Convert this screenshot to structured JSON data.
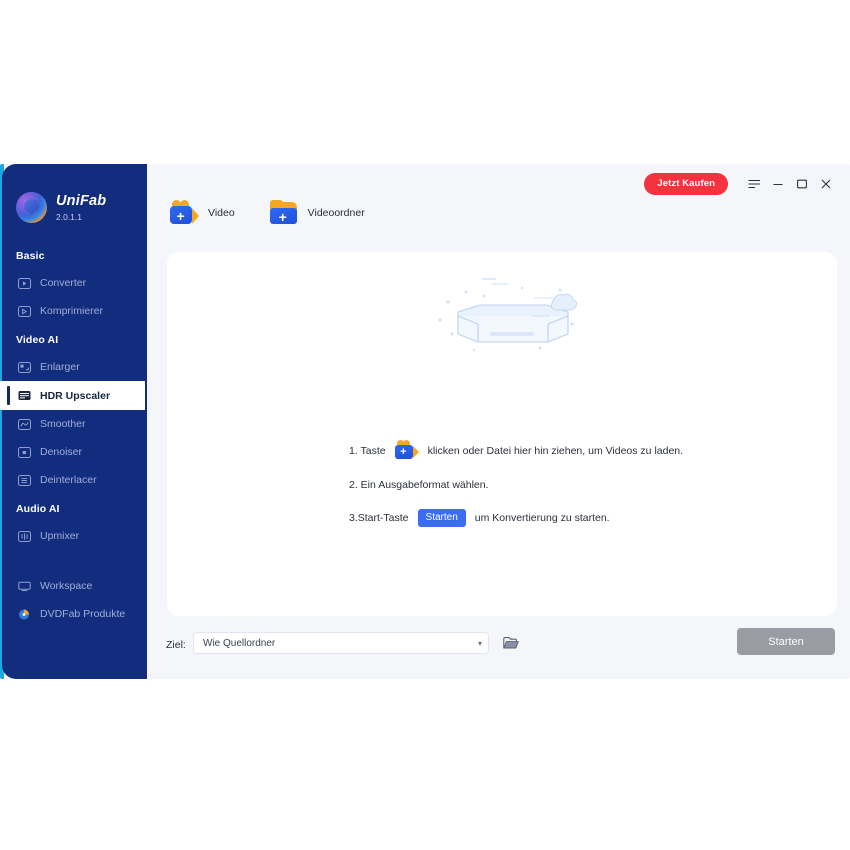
{
  "app": {
    "logo_name": "UniFab",
    "version": "2.0.1.1"
  },
  "titlebar": {
    "buy_label": "Jetzt Kaufen",
    "menu_icon": "hamburger-menu-icon",
    "minimize_icon": "minimize-icon",
    "maximize_icon": "maximize-icon",
    "close_icon": "close-icon"
  },
  "sidebar": {
    "groups": [
      {
        "title": "Basic"
      },
      {
        "title": "Video AI"
      },
      {
        "title": "Audio AI"
      }
    ],
    "items": [
      {
        "label": "Converter",
        "icon": "converter-icon",
        "selected": false
      },
      {
        "label": "Komprimierer",
        "icon": "compressor-icon",
        "selected": false
      },
      {
        "label": "Enlarger",
        "icon": "enlarger-icon",
        "selected": false
      },
      {
        "label": "HDR Upscaler",
        "icon": "hdr-upscaler-icon",
        "selected": true
      },
      {
        "label": "Smoother",
        "icon": "smoother-icon",
        "selected": false
      },
      {
        "label": "Denoiser",
        "icon": "denoiser-icon",
        "selected": false
      },
      {
        "label": "Deinterlacer",
        "icon": "deinterlacer-icon",
        "selected": false
      },
      {
        "label": "Upmixer",
        "icon": "upmixer-icon",
        "selected": false
      },
      {
        "label": "Workspace",
        "icon": "workspace-icon",
        "selected": false
      },
      {
        "label": "DVDFab Produkte",
        "icon": "dvdfab-icon",
        "selected": false
      }
    ]
  },
  "toolbar": {
    "add_video_label": "Video",
    "add_video_icon": "add-video-camera-icon",
    "add_folder_label": "Videoordner",
    "add_folder_icon": "add-video-folder-icon"
  },
  "dropzone": {
    "illustration_icon": "empty-box-illustration",
    "steps": {
      "step1_prefix": "1. Taste",
      "step1_suffix": "klicken oder Datei hier hin ziehen, um Videos zu laden.",
      "step1_icon": "add-video-camera-icon",
      "step2": "2. Ein Ausgabeformat wählen.",
      "step3_prefix": "3.Start-Taste",
      "step3_chip": "Starten",
      "step3_suffix": "um Konvertierung zu starten."
    }
  },
  "bottombar": {
    "dest_label": "Ziel:",
    "dest_value": "Wie Quellordner",
    "dest_caret_icon": "chevron-down-icon",
    "browse_icon": "folder-open-icon",
    "start_label": "Starten"
  },
  "colors": {
    "sidebar_bg": "#122c7e",
    "accent_cyan": "#1ea7e1",
    "buy_red": "#f5333f",
    "chip_blue": "#3b6df2",
    "start_disabled": "#9a9ca3",
    "content_bg": "#f5f6fa"
  }
}
